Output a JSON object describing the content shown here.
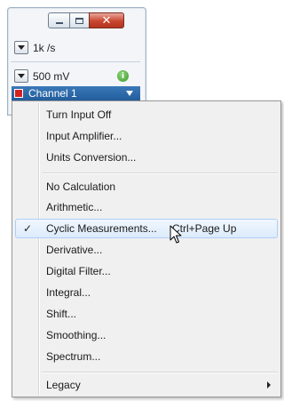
{
  "rate": {
    "value": "1k /s"
  },
  "range": {
    "value": "500 mV"
  },
  "channel": {
    "label": "Channel 1",
    "color": "#d62020"
  },
  "menu": {
    "items": [
      {
        "label": "Turn Input Off"
      },
      {
        "label": "Input Amplifier..."
      },
      {
        "label": "Units Conversion..."
      },
      {
        "label": "No Calculation"
      },
      {
        "label": "Arithmetic..."
      },
      {
        "label": "Cyclic Measurements...",
        "shortcut": "Ctrl+Page Up",
        "checked": true,
        "check": "✓"
      },
      {
        "label": "Derivative..."
      },
      {
        "label": "Digital Filter..."
      },
      {
        "label": "Integral..."
      },
      {
        "label": "Shift..."
      },
      {
        "label": "Smoothing..."
      },
      {
        "label": "Spectrum..."
      },
      {
        "label": "Legacy",
        "submenu": true
      }
    ]
  },
  "icons": {
    "minimize": "minimize-icon",
    "maximize": "maximize-icon",
    "close": "close-icon",
    "info": "info-icon",
    "cursor": "mouse-pointer-icon"
  },
  "glyphs": {
    "close": "✕",
    "info": "i"
  },
  "colors": {
    "highlight_border": "#aecff7",
    "channel_bar": "#2a66a6"
  }
}
